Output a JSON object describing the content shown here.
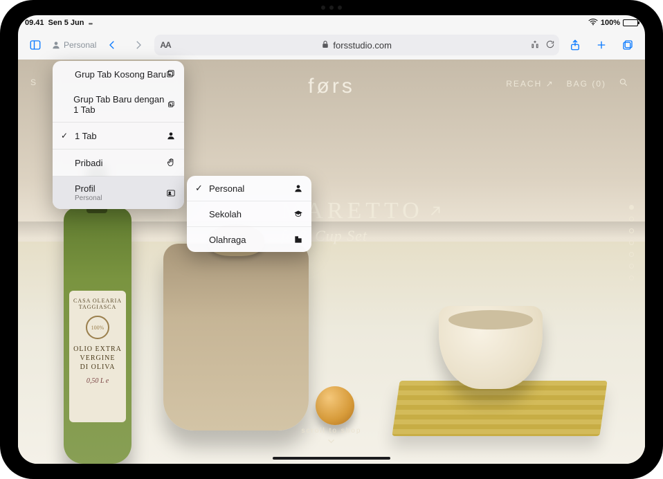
{
  "status": {
    "time": "09.41",
    "date": "Sen 5 Jun",
    "battery_pct": "100%"
  },
  "toolbar": {
    "profile": "Personal",
    "url": "forsstudio.com",
    "reader_label": "AA"
  },
  "menu": {
    "items": [
      {
        "label": "Grup Tab Kosong Baru",
        "icon": "tabgroup-new"
      },
      {
        "label": "Grup Tab Baru dengan 1 Tab",
        "icon": "tabgroup-new"
      },
      {
        "label": "1 Tab",
        "checked": true,
        "icon": "person"
      },
      {
        "label": "Pribadi",
        "icon": "hand"
      },
      {
        "label": "Profil",
        "sub": "Personal",
        "selected": true,
        "icon": "profile-card"
      }
    ]
  },
  "submenu": {
    "items": [
      {
        "label": "Personal",
        "checked": true,
        "icon": "person"
      },
      {
        "label": "Sekolah",
        "icon": "graduation"
      },
      {
        "label": "Olahraga",
        "icon": "building"
      }
    ]
  },
  "site": {
    "brand": "førs",
    "nav_shop": "S",
    "nav_reach": "REACH",
    "nav_bag": "BAG (0)",
    "headline1": "MARETTO",
    "headline2": "fe & Cup Set",
    "scroll": "scroll to shop",
    "bottle": {
      "line1": "CASA OLEARIA TAGGIASCA",
      "seal": "100%",
      "big": "OLIO EXTRA\nVERGINE\nDI OLIVA",
      "vol": "0,50 L e"
    },
    "dot_count": 7
  }
}
